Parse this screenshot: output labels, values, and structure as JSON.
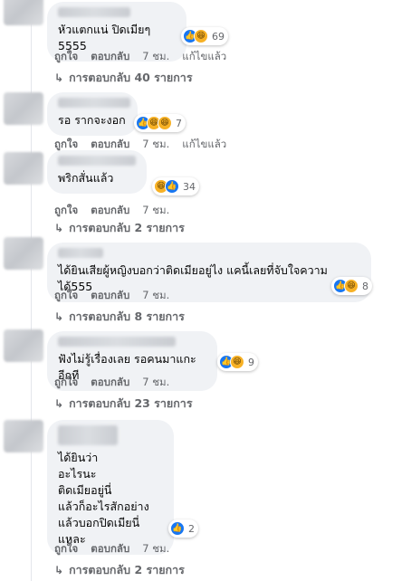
{
  "comments": [
    {
      "text": "หัวแตกแน่ ปิดเมียๆ 5555",
      "reactions": [
        "like",
        "haha"
      ],
      "count": "69",
      "like": "ถูกใจ",
      "reply": "ตอบกลับ",
      "time": "7 ชม.",
      "edited": "แก้ไขแล้ว",
      "replies": "การตอบกลับ 40 รายการ"
    },
    {
      "text": "รอ รากจะงอก",
      "reactions": [
        "like",
        "haha",
        "haha"
      ],
      "count": "7",
      "like": "ถูกใจ",
      "reply": "ตอบกลับ",
      "time": "7 ชม.",
      "edited": "แก้ไขแล้ว"
    },
    {
      "text": "พริกสั่นแล้ว",
      "reactions": [
        "haha",
        "like"
      ],
      "count": "34",
      "like": "ถูกใจ",
      "reply": "ตอบกลับ",
      "time": "7 ชม.",
      "replies": "การตอบกลับ 2 รายการ"
    },
    {
      "text": "ได้ยินเสียผู้หญิงบอกว่าติดเมียอยู่ไง แคนี้เลยที่จับใจความได้555",
      "reactions": [
        "like",
        "haha"
      ],
      "count": "8",
      "like": "ถูกใจ",
      "reply": "ตอบกลับ",
      "time": "7 ชม.",
      "replies": "การตอบกลับ 8 รายการ"
    },
    {
      "text": "ฟังไม่รู้เรื่องเลย รอคนมาแกะอีกที",
      "reactions": [
        "like",
        "haha"
      ],
      "count": "9",
      "like": "ถูกใจ",
      "reply": "ตอบกลับ",
      "time": "7 ชม.",
      "replies": "การตอบกลับ 23 รายการ"
    },
    {
      "text": "ได้ยินว่า\nอะไรนะ\nติดเมียอยู่นี่\nแล้วก็อะไรสักอย่าง\nแล้วบอกปิดเมียนี่แหละ",
      "reactions": [
        "like"
      ],
      "count": "2",
      "like": "ถูกใจ",
      "reply": "ตอบกลับ",
      "time": "7 ชม.",
      "replies": "การตอบกลับ 2 รายการ"
    }
  ],
  "colors": {
    "like": "#1877f2",
    "haha": "#f7b125",
    "bubble": "#f0f2f5",
    "meta": "#65676b"
  }
}
